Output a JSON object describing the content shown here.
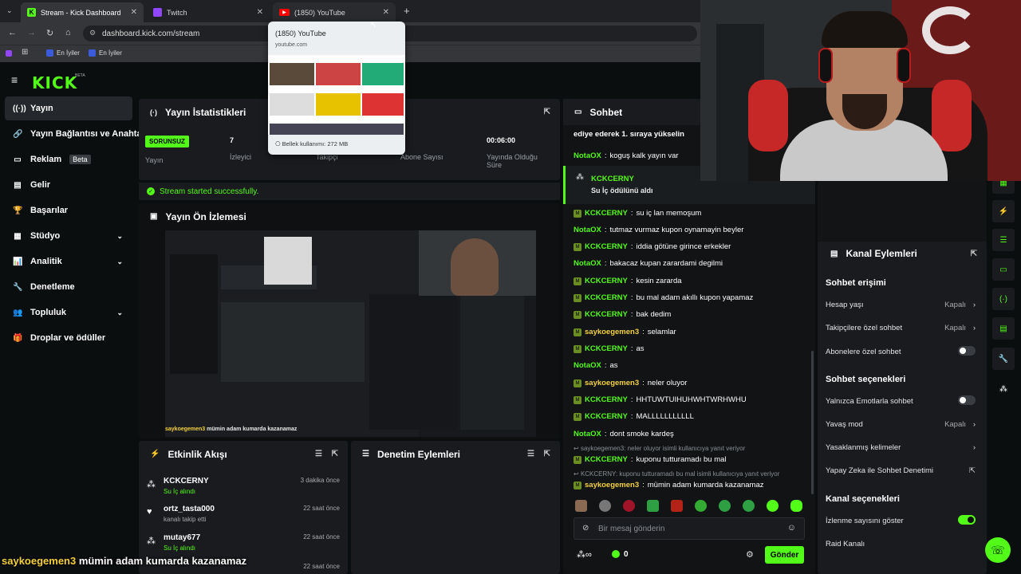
{
  "browser": {
    "tabs": [
      {
        "title": "Stream - Kick Dashboard",
        "active": true
      },
      {
        "title": "Twitch",
        "active": false
      },
      {
        "title": "(1850) YouTube",
        "active": false
      }
    ],
    "url": "dashboard.kick.com/stream",
    "bookmarks": [
      "En İyiler",
      "En İyiler"
    ],
    "hover_card": {
      "title": "(1850) YouTube",
      "domain": "youtube.com",
      "memory": "Bellek kullanımı: 272 MB"
    }
  },
  "nav": {
    "logo": "KICK",
    "logo_sup": "BETA"
  },
  "sidebar": {
    "items": [
      {
        "label": "Yayın",
        "icon": "broadcast-icon"
      },
      {
        "label": "Yayın Bağlantısı ve Anahtarı",
        "icon": "link-icon"
      },
      {
        "label": "Reklam",
        "badge": "Beta",
        "icon": "ad-icon"
      },
      {
        "label": "Gelir",
        "icon": "wallet-icon"
      },
      {
        "label": "Başarılar",
        "icon": "trophy-icon"
      },
      {
        "label": "Stüdyo",
        "icon": "studio-icon"
      },
      {
        "label": "Analitik",
        "icon": "analytics-icon"
      },
      {
        "label": "Denetleme",
        "icon": "wrench-icon"
      },
      {
        "label": "Topluluk",
        "icon": "community-icon"
      },
      {
        "label": "Droplar ve ödüller",
        "icon": "gift-icon"
      }
    ]
  },
  "stats": {
    "title": "Yayın İstatistikleri",
    "status_badge": "SORUNSUZ",
    "status_label": "Yayın",
    "viewers_value": "7",
    "viewers_label": "İzleyici",
    "followers_label": "Takipçi",
    "subs_label": "Abone Sayısı",
    "uptime_value": "00:06:00",
    "uptime_label": "Yayında Olduğu Süre",
    "success_msg": "Stream started successfully."
  },
  "preview": {
    "title": "Yayın Ön İzlemesi",
    "overlay_user": "saykoegemen3",
    "overlay_msg": "mümin adam kumarda kazanamaz"
  },
  "activity": {
    "title": "Etkinlik Akışı",
    "items": [
      {
        "name": "KCKCERNY",
        "sub": "Su İç alındı",
        "time": "3 dakika önce"
      },
      {
        "name": "ortz_tasta000",
        "sub": "kanalı takip etti",
        "time": "22 saat önce"
      },
      {
        "name": "mutay677",
        "sub": "Su İç alındı",
        "time": "22 saat önce"
      },
      {
        "name": "",
        "sub": "",
        "time": "22 saat önce"
      }
    ]
  },
  "moderation": {
    "title": "Denetim Eylemleri"
  },
  "chat": {
    "title": "Sohbet",
    "top_text": "ediye ederek 1. sıraya yükselin",
    "highlight": {
      "user": "KCKCERNY",
      "text": "Su İç ödülünü aldı"
    },
    "messages": [
      {
        "user": "NotaOX",
        "text": "koguş kalk yayın var",
        "color": "green",
        "badge": false
      },
      {
        "user": "KCKCERNY",
        "text": "su iç lan memoşum",
        "color": "green",
        "badge": true
      },
      {
        "user": "NotaOX",
        "text": "tutmaz vurmaz kupon oynamayin beyler",
        "color": "green",
        "badge": false
      },
      {
        "user": "KCKCERNY",
        "text": "iddia götüne girince erkekler",
        "color": "green",
        "badge": true
      },
      {
        "user": "NotaOX",
        "text": "bakacaz kupan zarardami degilmi",
        "color": "green",
        "badge": false
      },
      {
        "user": "KCKCERNY",
        "text": "kesin zararda",
        "color": "green",
        "badge": true
      },
      {
        "user": "KCKCERNY",
        "text": "bu mal adam akıllı kupon yapamaz",
        "color": "green",
        "badge": true
      },
      {
        "user": "KCKCERNY",
        "text": "bak dedim",
        "color": "green",
        "badge": true
      },
      {
        "user": "saykoegemen3",
        "text": "selamlar",
        "color": "yellow",
        "badge": true
      },
      {
        "user": "KCKCERNY",
        "text": "as",
        "color": "green",
        "badge": true
      },
      {
        "user": "NotaOX",
        "text": "as",
        "color": "green",
        "badge": false
      },
      {
        "user": "saykoegemen3",
        "text": "neler oluyor",
        "color": "yellow",
        "badge": true
      },
      {
        "user": "KCKCERNY",
        "text": "HHTUWTUIHUHWHTWRHWHU",
        "color": "green",
        "badge": true
      },
      {
        "user": "KCKCERNY",
        "text": "MALLLLLLLLLLL",
        "color": "green",
        "badge": true
      },
      {
        "user": "NotaOX",
        "text": "dont smoke kardeş",
        "color": "green",
        "badge": false
      }
    ],
    "reply1_hint": "saykoegemen3: neler oluyor isimli kullanıcıya yanıt veriyor",
    "reply1": {
      "user": "KCKCERNY",
      "text": "kuponu tutturamadı bu mal"
    },
    "reply2_hint": "KCKCERNY: kuponu tutturamadı bu mal isimli kullanıcıya yanıt veriyor",
    "reply2": {
      "user": "saykoegemen3",
      "text": "mümin adam kumarda kazanamaz"
    },
    "input_placeholder": "Bir mesaj gönderin",
    "points": "0",
    "send": "Gönder"
  },
  "channel_actions": {
    "title": "Kanal Eylemleri",
    "chat_access": "Sohbet erişimi",
    "account_age": "Hesap yaşı",
    "account_age_val": "Kapalı",
    "followers_only": "Takipçilere özel sohbet",
    "followers_only_val": "Kapalı",
    "subs_only": "Abonelere özel sohbet",
    "chat_options": "Sohbet seçenekleri",
    "emote_only": "Yalnızca Emotlarla sohbet",
    "slow_mode": "Yavaş mod",
    "slow_mode_val": "Kapalı",
    "banned_words": "Yasaklanmış kelimeler",
    "ai_mod": "Yapay Zeka ile Sohbet Denetimi",
    "channel_options": "Kanal seçenekleri",
    "show_viewers": "İzlenme sayısını göster",
    "raid": "Raid Kanalı"
  },
  "bottom_overlay": {
    "user": "saykoegemen3",
    "msg": "mümin adam kumarda kazanamaz"
  },
  "colors": {
    "accent": "#53fc18",
    "bg": "#0b0e0f",
    "panel": "#191b1f"
  }
}
